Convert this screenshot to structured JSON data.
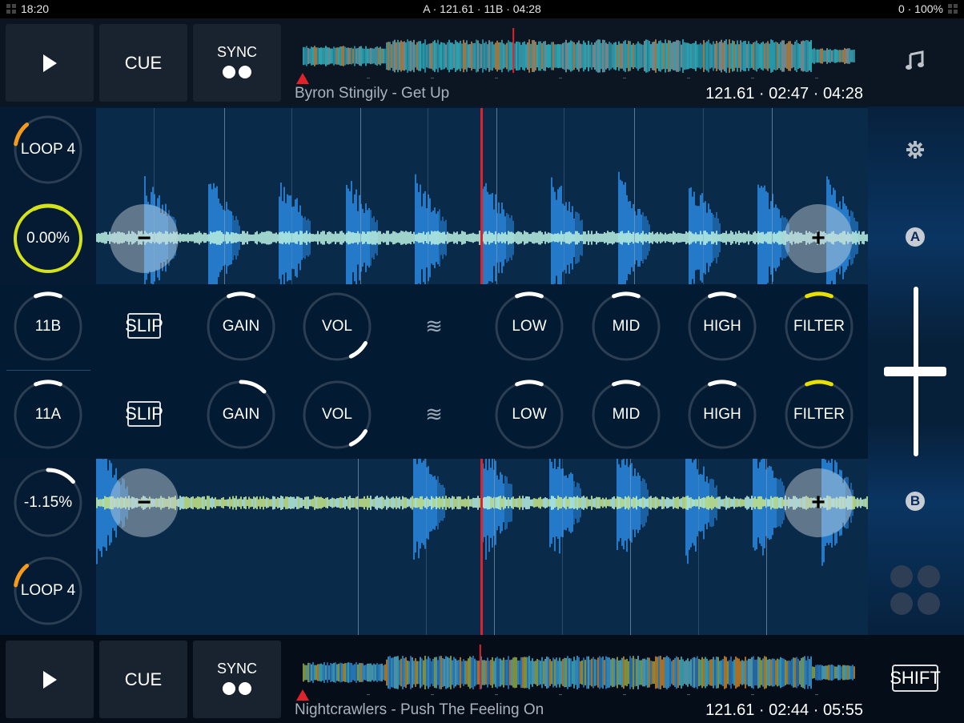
{
  "status_bar": {
    "time": "18:20",
    "center": "A · 121.61 · 11B · 04:28",
    "right": "0 · 100%"
  },
  "deck_a": {
    "play_label": "play",
    "cue_label": "CUE",
    "sync_label": "SYNC",
    "track_title": "Byron Stingily - Get Up",
    "track_info": "121.61 · 02:47 · 04:28",
    "playhead_fraction": 0.38,
    "loop_label": "LOOP 4",
    "pitch_label": "0.00%",
    "key_label": "11B",
    "slip_label": "SLIP",
    "badge": "A",
    "zoom_minus": "−",
    "zoom_plus": "+",
    "accent_color": "#d4e21a"
  },
  "deck_b": {
    "play_label": "play",
    "cue_label": "CUE",
    "sync_label": "SYNC",
    "track_title": "Nightcrawlers - Push The Feeling On",
    "track_info": "121.61 · 02:44 · 05:55",
    "playhead_fraction": 0.32,
    "loop_label": "LOOP 4",
    "pitch_label": "-1.15%",
    "key_label": "11A",
    "slip_label": "SLIP",
    "badge": "B",
    "zoom_minus": "−",
    "zoom_plus": "+"
  },
  "mixer": {
    "row_a": {
      "gain": "GAIN",
      "vol": "VOL",
      "low": "LOW",
      "mid": "MID",
      "high": "HIGH",
      "filter": "FILTER",
      "eq_icon": "≋"
    },
    "row_b": {
      "gain": "GAIN",
      "vol": "VOL",
      "low": "LOW",
      "mid": "MID",
      "high": "HIGH",
      "filter": "FILTER",
      "eq_icon": "≋"
    },
    "crossfader_position": 0.5
  },
  "side": {
    "music_icon": "♫",
    "shift_label": "SHIFT"
  },
  "colors": {
    "playhead": "#e0232a",
    "loop_arc": "#f59a1a",
    "filter_arc": "#e8e000",
    "knob_ring": "#2c3f52"
  }
}
